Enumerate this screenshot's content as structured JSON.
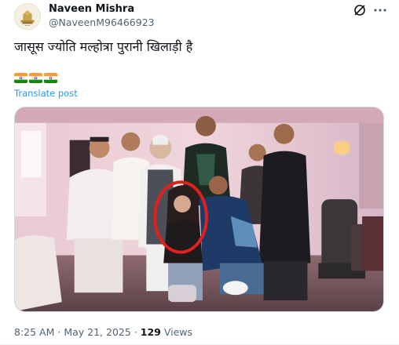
{
  "post": {
    "author_name": "Naveen Mishra",
    "author_handle": "@NaveenM96466923",
    "text": "जासूस ज्योति मल्होत्रा पुरानी खिलाड़ी है",
    "flags": [
      "indian-flag",
      "indian-flag",
      "indian-flag"
    ],
    "translate_label": "Translate post",
    "time": "8:25 AM",
    "separator": "·",
    "date": "May 21, 2025",
    "views_count": "129",
    "views_label": "Views"
  },
  "icons": {
    "grok": "grok-icon",
    "more": "more-options-icon",
    "avatar": "emblem-avatar"
  },
  "colors": {
    "link": "#1d9bf0",
    "secondary_text": "#536471",
    "primary_text": "#0f1419",
    "highlight_circle": "#e0201c"
  }
}
